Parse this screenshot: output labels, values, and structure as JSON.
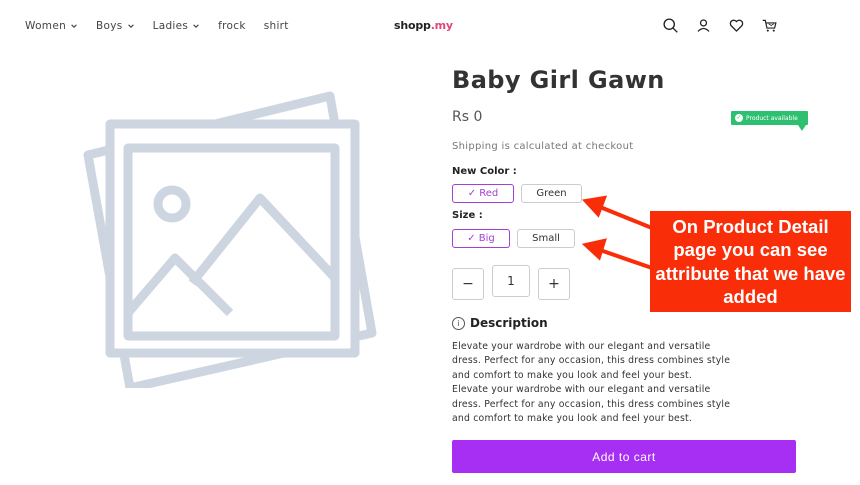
{
  "nav": {
    "items": [
      {
        "label": "Women",
        "dropdown": true
      },
      {
        "label": "Boys",
        "dropdown": true
      },
      {
        "label": "Ladies",
        "dropdown": true
      },
      {
        "label": "frock",
        "dropdown": false
      },
      {
        "label": "shirt",
        "dropdown": false
      }
    ],
    "logo": {
      "text": "shopp",
      "suffix": ".my"
    },
    "icons": [
      "search-icon",
      "user-icon",
      "heart-icon",
      "cart-icon"
    ]
  },
  "product": {
    "title": "Baby Girl Gawn",
    "price": "Rs 0",
    "availability": "Product available",
    "shipping": "Shipping is calculated at checkout",
    "color_label": "New Color :",
    "colors": [
      {
        "label": "✓ Red",
        "selected": true
      },
      {
        "label": "Green",
        "selected": false
      }
    ],
    "size_label": "Size :",
    "sizes": [
      {
        "label": "✓ Big",
        "selected": true
      },
      {
        "label": "Small",
        "selected": false
      }
    ],
    "quantity": {
      "minus": "−",
      "value": "1",
      "plus": "+"
    },
    "description_heading": "Description",
    "description_lines": [
      "Elevate your wardrobe with our elegant and versatile",
      "dress. Perfect for any occasion, this dress combines style",
      "and comfort to make you look and feel your best.",
      "Elevate your wardrobe with our elegant and versatile",
      "dress. Perfect for any occasion, this dress combines style",
      "and comfort to make you look and feel your best."
    ],
    "add_to_cart": "Add to cart"
  },
  "annotation": {
    "text": "On Product Detail page you can see attribute that we have added",
    "color": "#fa2d09"
  },
  "colors": {
    "accent": "#a72ef3",
    "available": "#2fbf71"
  }
}
